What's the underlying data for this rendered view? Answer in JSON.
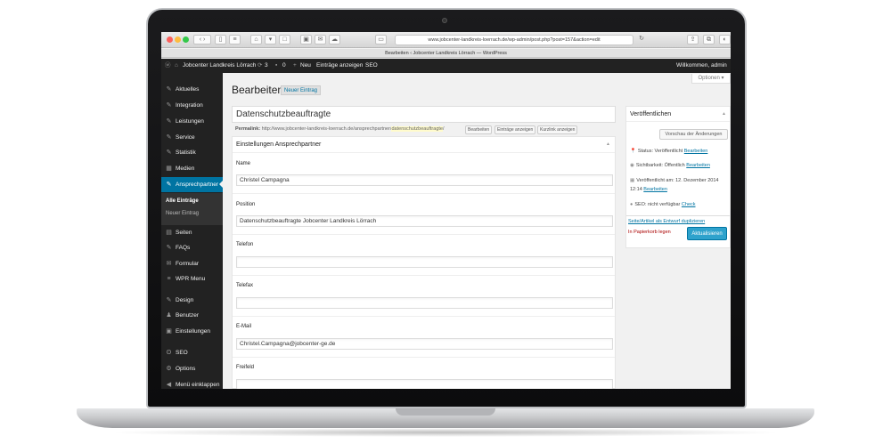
{
  "browser": {
    "url": "www.jobcenter-landkreis-loerrach.de/wp-admin/post.php?post=157&action=edit",
    "tab_title": "Bearbeiten ‹ Jobcenter Landkreis Lörrach — WordPress"
  },
  "adminbar": {
    "site_name": "Jobcenter Landkreis Lörrach",
    "updates": "3",
    "comments": "0",
    "new_label": "Neu",
    "view_entries": "Einträge anzeigen",
    "seo": "SEO",
    "welcome": "Willkommen, admin"
  },
  "menu": {
    "items": [
      {
        "label": "Aktuelles",
        "icon": "pin-icon"
      },
      {
        "label": "Integration",
        "icon": "pin-icon"
      },
      {
        "label": "Leistungen",
        "icon": "pin-icon"
      },
      {
        "label": "Service",
        "icon": "pin-icon"
      },
      {
        "label": "Statistik",
        "icon": "pin-icon"
      },
      {
        "label": "Medien",
        "icon": "media-icon"
      },
      {
        "label": "Ansprechpartner",
        "icon": "pin-icon"
      },
      {
        "label": "Seiten",
        "icon": "page-icon"
      },
      {
        "label": "FAQs",
        "icon": "pin-icon"
      },
      {
        "label": "Formular",
        "icon": "mail-icon"
      },
      {
        "label": "WPR Menu",
        "icon": "menu-icon"
      },
      {
        "label": "Design",
        "icon": "brush-icon"
      },
      {
        "label": "Benutzer",
        "icon": "user-icon"
      },
      {
        "label": "Einstellungen",
        "icon": "settings-icon"
      },
      {
        "label": "SEO",
        "icon": "seo-icon"
      },
      {
        "label": "Options",
        "icon": "gear-icon"
      },
      {
        "label": "Menü einklappen",
        "icon": "collapse-icon"
      }
    ],
    "submenu": [
      "Alle Einträge",
      "Neuer Eintrag"
    ]
  },
  "screen_options": "Optionen",
  "page": {
    "title": "Bearbeiten",
    "add_new": "Neuer Eintrag",
    "post_title": "Datenschutzbeauftragte",
    "permalink_label": "Permalink:",
    "permalink_base": "http://www.jobcenter-landkreis-loerrach.de/ansprechpartner/",
    "permalink_slug": "datenschutzbeauftragte",
    "permalink_end": "/",
    "btn_edit": "Bearbeiten",
    "btn_view": "Einträge anzeigen",
    "btn_shortlink": "Kurzlink anzeigen"
  },
  "metabox": {
    "title": "Einstellungen Ansprechpartner",
    "fields": [
      {
        "label": "Name",
        "value": "Christel Campagna"
      },
      {
        "label": "Position",
        "value": "Datenschutzbeauftragte Jobcenter Landkreis Lörrach"
      },
      {
        "label": "Telefon",
        "value": ""
      },
      {
        "label": "Telefax",
        "value": ""
      },
      {
        "label": "E-Mail",
        "value": "Christel.Campagna@jobcenter-ge.de"
      },
      {
        "label": "Freifeld",
        "value": ""
      }
    ]
  },
  "publish": {
    "title": "Veröffentlichen",
    "preview": "Vorschau der Änderungen",
    "status": "Status: Veröffentlicht",
    "visibility": "Sichtbarkeit: Öffentlich",
    "published_on": "Veröffentlicht am: 12. Dezember 2014",
    "published_time": "12:14",
    "seo": "SEO: nicht verfügbar",
    "edit_link": "Bearbeiten",
    "check_link": "Check",
    "duplicate": "Seite/Artikel als Entwurf duplizieren",
    "trash": "In Papierkorb legen",
    "update": "Aktualisieren"
  },
  "colors": {
    "admin_dark": "#222222",
    "accent_blue": "#0074a2",
    "button_blue": "#2ea2cc",
    "trash_red": "#aa0000"
  }
}
